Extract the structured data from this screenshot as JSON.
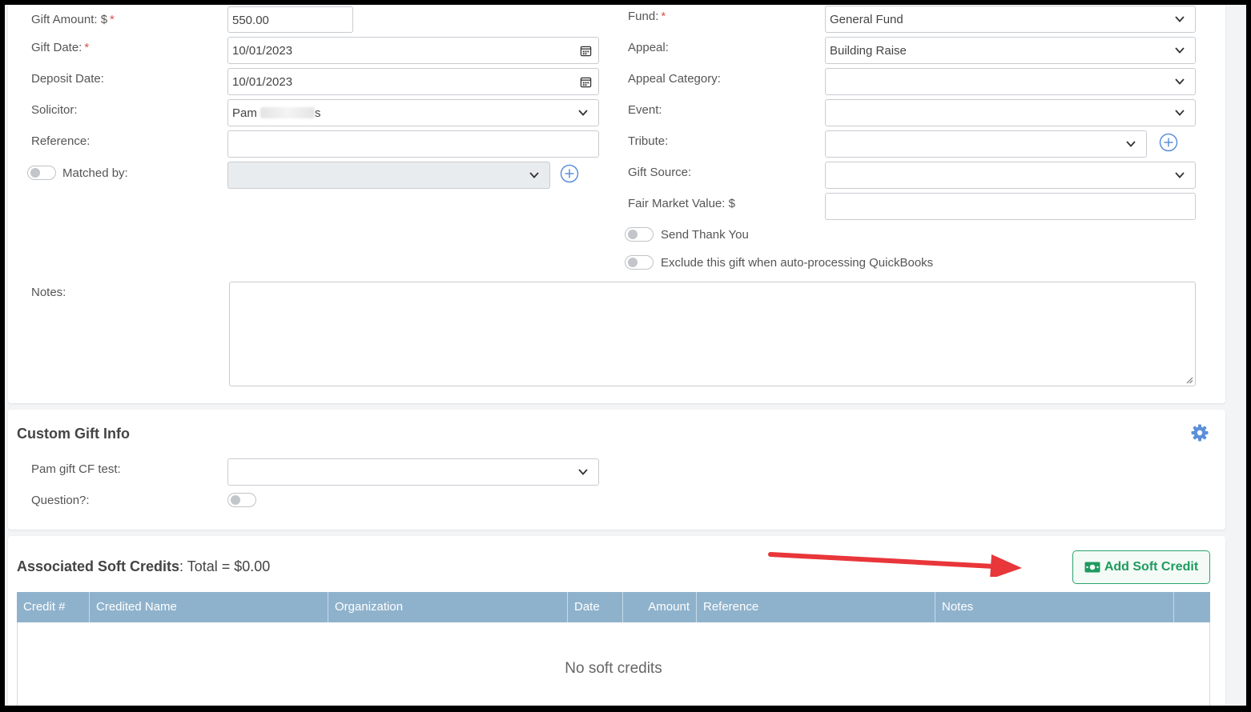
{
  "left_fields": {
    "gift_amount": {
      "label": "Gift Amount: $",
      "required": "*",
      "value": "550.00"
    },
    "gift_date": {
      "label": "Gift Date:",
      "required": "*",
      "value": "10/01/2023"
    },
    "deposit_date": {
      "label": "Deposit Date:",
      "value": "10/01/2023"
    },
    "solicitor": {
      "label": "Solicitor:",
      "value_start": "Pam",
      "value_end": "s"
    },
    "reference": {
      "label": "Reference:",
      "value": ""
    },
    "matched_by": {
      "label": "Matched by:",
      "value": ""
    }
  },
  "right_fields": {
    "fund": {
      "label": "Fund:",
      "required": "*",
      "value": "General Fund"
    },
    "appeal": {
      "label": "Appeal:",
      "value": "Building Raise"
    },
    "appeal_category": {
      "label": "Appeal Category:",
      "value": ""
    },
    "event": {
      "label": "Event:",
      "value": ""
    },
    "tribute": {
      "label": "Tribute:",
      "value": ""
    },
    "gift_source": {
      "label": "Gift Source:",
      "value": ""
    },
    "fair_market_value": {
      "label": "Fair Market Value: $",
      "value": ""
    },
    "send_thank_you": {
      "label": "Send Thank You"
    },
    "exclude_quickbooks": {
      "label": "Exclude this gift when auto-processing QuickBooks"
    }
  },
  "notes": {
    "label": "Notes:",
    "value": ""
  },
  "custom_gift_info": {
    "title": "Custom Gift Info",
    "pam_gift_cf_test": {
      "label": "Pam gift CF test:",
      "value": ""
    },
    "question": {
      "label": "Question?:"
    }
  },
  "soft_credits": {
    "title": "Associated Soft Credits",
    "total_text": ": Total = $0.00",
    "add_button": "Add Soft Credit",
    "columns": [
      "Credit #",
      "Credited Name",
      "Organization",
      "Date",
      "Amount",
      "Reference",
      "Notes"
    ],
    "empty_message": "No soft credits"
  },
  "colors": {
    "accent_blue": "#5b8fd9",
    "button_green": "#2aa36b",
    "table_header": "#8fb2cc",
    "arrow_red": "#e8363a",
    "required_red": "#d9534f"
  },
  "icons": [
    "chevron-down-icon",
    "calendar-icon",
    "plus-circle-icon",
    "gear-icon",
    "money-icon",
    "annotation-arrow"
  ]
}
